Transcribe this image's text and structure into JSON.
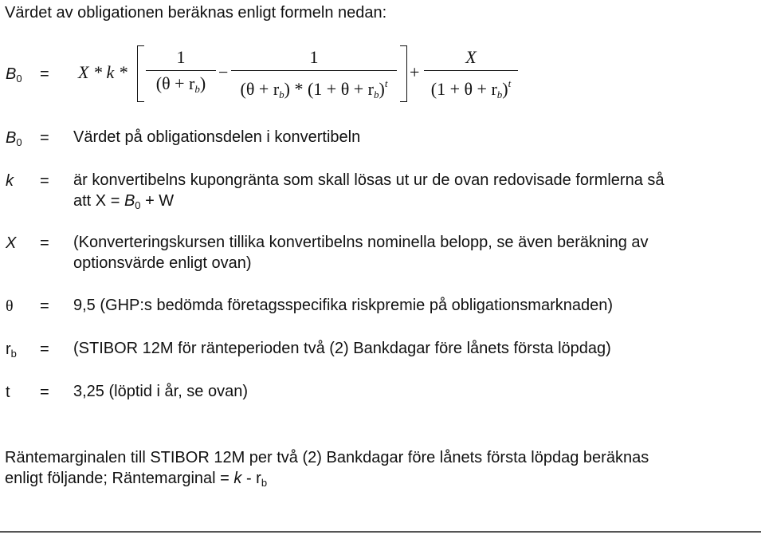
{
  "intro": "Värdet av obligationen beräknas enligt formeln nedan:",
  "formula": {
    "lhs": "B",
    "lhs_sub": "0",
    "equals": "=",
    "prefix": "X * k *",
    "term1_num": "1",
    "term1_den": "(θ + r",
    "term1_den_sub": "b",
    "term1_den_end": ")",
    "minus": "−",
    "term2_num": "1",
    "term2_den_a": "(θ + r",
    "term2_den_sub1": "b",
    "term2_den_b": ") * (1 + θ + r",
    "term2_den_sub2": "b",
    "term2_den_c": ")",
    "term2_den_sup": "t",
    "plus": "+",
    "term3_num": "X",
    "term3_den_a": "(1 + θ + r",
    "term3_den_sub": "b",
    "term3_den_b": ")",
    "term3_den_sup": "t"
  },
  "definitions": [
    {
      "symbol": "B",
      "symbol_sub": "0",
      "eq": "=",
      "line1": "Värdet på obligationsdelen i konvertibeln"
    },
    {
      "symbol": "k",
      "eq": "=",
      "line1": "är konvertibelns kupongränta som skall lösas ut ur de ovan redovisade formlerna så",
      "line2_a": "att X = ",
      "line2_b": "B",
      "line2_sub": "0",
      "line2_c": " + W"
    },
    {
      "symbol": "X",
      "eq": "=",
      "line1": "(Konverteringskursen tillika konvertibelns nominella belopp, se även beräkning av",
      "line2": "optionsvärde enligt ovan)"
    },
    {
      "symbol": "θ",
      "eq": "=",
      "line1": "9,5 (GHP:s bedömda företagsspecifika riskpremie på obligationsmarknaden)"
    },
    {
      "symbol": "r",
      "symbol_sub": "b",
      "eq": "=",
      "line1": "(STIBOR 12M för ränteperioden två (2) Bankdagar före lånets första löpdag)"
    },
    {
      "symbol": "t",
      "eq": "=",
      "line1": "3,25 (löptid i år, se ovan)"
    }
  ],
  "footer": {
    "line1": "Räntemarginalen till STIBOR 12M per två (2) Bankdagar före lånets första löpdag beräknas",
    "line2_a": "enligt följande; Räntemarginal = ",
    "line2_k": "k",
    "line2_b": " - r",
    "line2_sub": "b"
  }
}
